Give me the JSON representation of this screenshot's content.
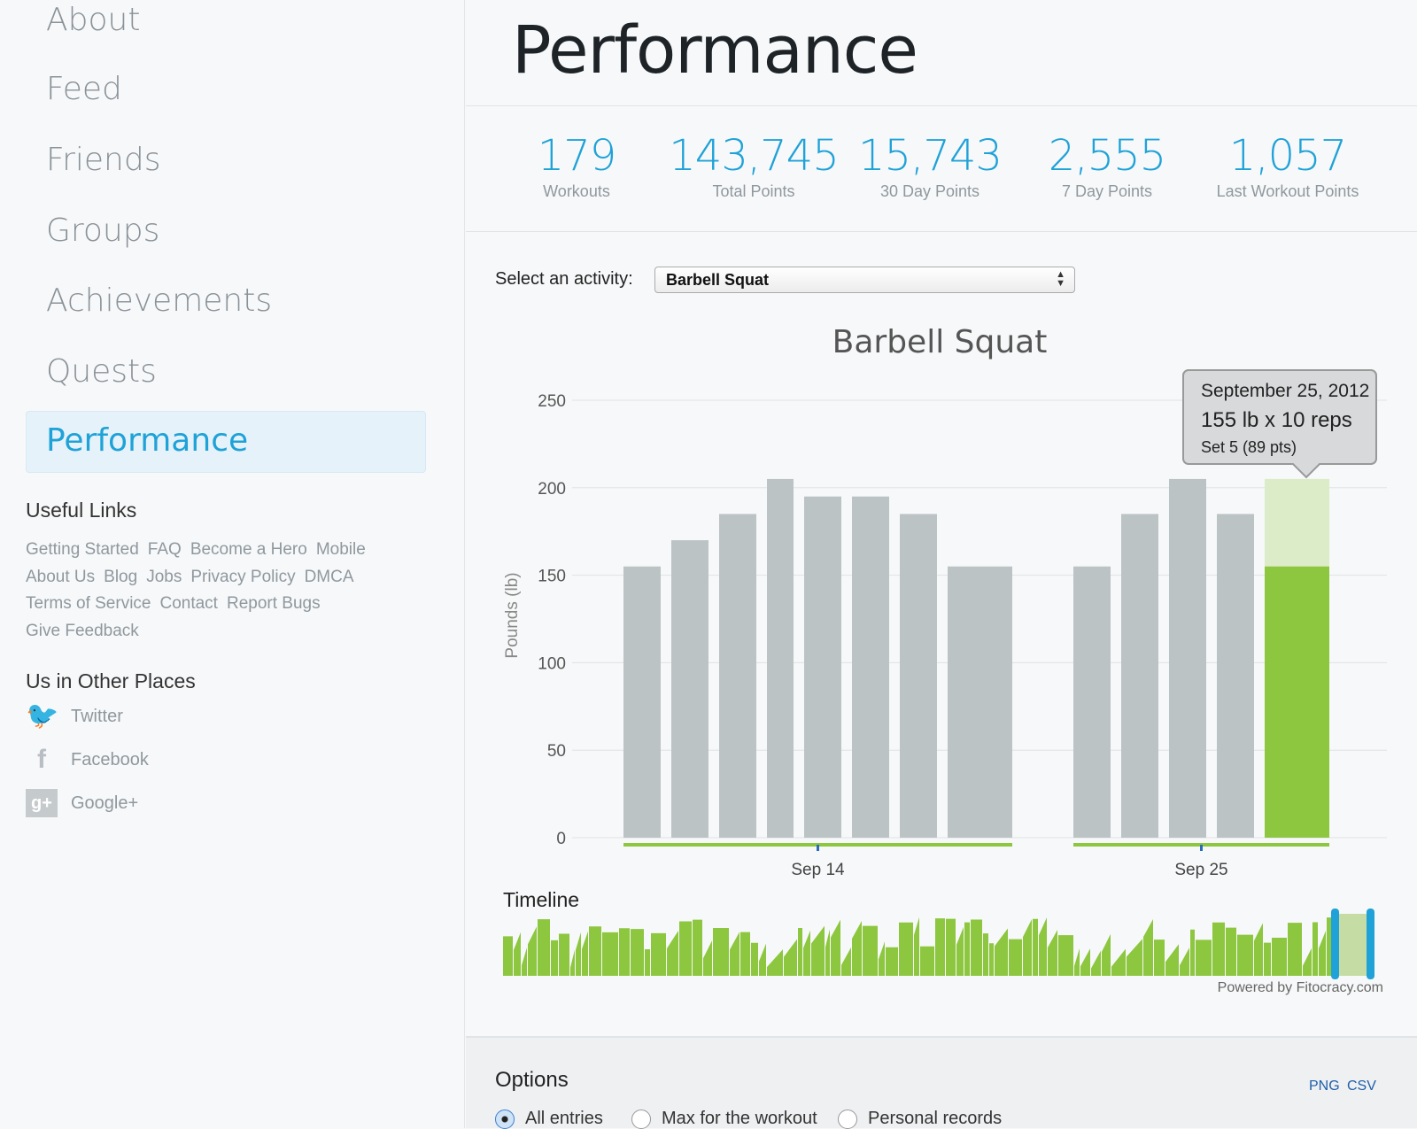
{
  "sidebar": {
    "nav": [
      "About",
      "Feed",
      "Friends",
      "Groups",
      "Achievements",
      "Quests"
    ],
    "active": "Performance",
    "useful_links_heading": "Useful Links",
    "links": [
      "Getting Started",
      "FAQ",
      "Become a Hero",
      "Mobile",
      "About Us",
      "Blog",
      "Jobs",
      "Privacy Policy",
      "DMCA",
      "Terms of Service",
      "Contact",
      "Report Bugs",
      "Give Feedback"
    ],
    "other_places_heading": "Us in Other Places",
    "social": [
      {
        "label": "Twitter",
        "icon": "twitter-icon"
      },
      {
        "label": "Facebook",
        "icon": "facebook-icon"
      },
      {
        "label": "Google+",
        "icon": "google-plus-icon"
      }
    ]
  },
  "header": {
    "title": "Performance"
  },
  "stats": [
    {
      "value": "179",
      "label": "Workouts"
    },
    {
      "value": "143,745",
      "label": "Total Points"
    },
    {
      "value": "15,743",
      "label": "30 Day Points"
    },
    {
      "value": "2,555",
      "label": "7 Day Points"
    },
    {
      "value": "1,057",
      "label": "Last Workout Points"
    }
  ],
  "activity": {
    "label": "Select an activity:",
    "selected": "Barbell Squat"
  },
  "chart_data": {
    "type": "bar",
    "title": "Barbell Squat",
    "ylabel": "Pounds (lb)",
    "ylim": [
      0,
      250
    ],
    "yticks": [
      0,
      50,
      100,
      150,
      200,
      250
    ],
    "grid": true,
    "groups": [
      {
        "label": "Sep 14",
        "values": [
          155,
          170,
          185,
          205,
          195,
          195,
          185,
          155
        ]
      },
      {
        "label": "Sep 25",
        "values": [
          155,
          185,
          205,
          185,
          155
        ],
        "highlight_index": 4,
        "highlight_max": 205
      }
    ],
    "colors": {
      "bar": "#bcc3c5",
      "highlight": "#8dc63f",
      "highlight_bg": "#dcebc8",
      "axis_line": "#8dc63f"
    },
    "tooltip": {
      "date": "September 25, 2012",
      "value": "155 lb x 10 reps",
      "detail": "Set 5 (89 pts)"
    }
  },
  "timeline": {
    "label": "Timeline",
    "credit": "Powered by Fitocracy.com",
    "color": "#8dc63f",
    "handle_color": "#1fa2d8"
  },
  "options": {
    "heading": "Options",
    "png": "PNG",
    "csv": "CSV",
    "radios": [
      {
        "label": "All entries",
        "checked": true
      },
      {
        "label": "Max for the workout",
        "checked": false
      },
      {
        "label": "Personal records",
        "checked": false
      }
    ]
  }
}
